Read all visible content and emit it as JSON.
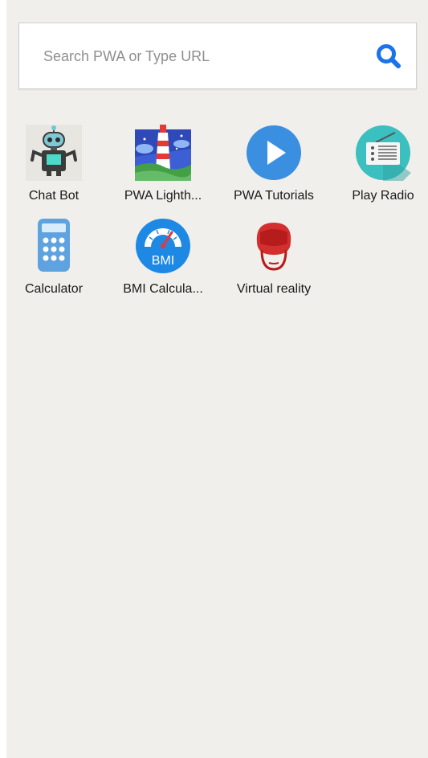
{
  "search": {
    "placeholder": "Search PWA or Type URL",
    "value": ""
  },
  "apps": [
    {
      "label": "Chat Bot",
      "icon": "robot-icon"
    },
    {
      "label": "PWA Lighth...",
      "icon": "lighthouse-icon"
    },
    {
      "label": "PWA Tutorials",
      "icon": "play-icon"
    },
    {
      "label": "Play Radio",
      "icon": "radio-icon"
    },
    {
      "label": "Calculator",
      "icon": "calculator-icon"
    },
    {
      "label": "BMI Calcula...",
      "icon": "bmi-gauge-icon",
      "icon_text": "BMI"
    },
    {
      "label": "Virtual reality",
      "icon": "vr-headset-icon"
    }
  ],
  "colors": {
    "background": "#f1efeb",
    "search_icon": "#1a73e8",
    "play_blue": "#3b8fe0",
    "radio_teal": "#3cbfbf",
    "calculator_blue": "#5ea3e0",
    "vr_red": "#d32f2f"
  }
}
